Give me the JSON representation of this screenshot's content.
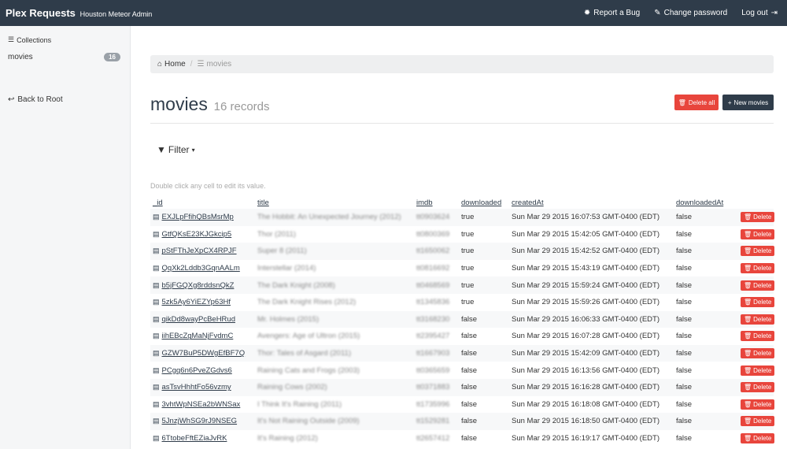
{
  "topbar": {
    "brand": "Plex Requests",
    "subtitle": "Houston Meteor Admin",
    "links": [
      {
        "icon": "bug-icon",
        "label": "Report a Bug"
      },
      {
        "icon": "pencil-icon",
        "label": "Change password"
      },
      {
        "icon": "logout-icon",
        "label": "Log out"
      }
    ]
  },
  "sidebar": {
    "header": "Collections",
    "items": [
      {
        "label": "movies",
        "count": "16"
      }
    ],
    "back": "Back to Root"
  },
  "breadcrumb": {
    "home": "Home",
    "current": "movies"
  },
  "page": {
    "title": "movies",
    "count": "16 records",
    "delete_all": "Delete all",
    "new": "New movies",
    "filter": "Filter",
    "hint": "Double click any cell to edit its value."
  },
  "table": {
    "headers": {
      "id": "_id",
      "title": "title",
      "imdb": "imdb",
      "downloaded": "downloaded",
      "createdAt": "createdAt",
      "downloadedAt": "downloadedAt"
    },
    "delete_label": "Delete",
    "rows": [
      {
        "id": "EXJLpFfihQBsMsrMp",
        "title": "The Hobbit: An Unexpected Journey (2012)",
        "imdb": "tt0903624",
        "downloaded": "true",
        "createdAt": "Sun Mar 29 2015 16:07:53 GMT-0400 (EDT)",
        "downloadedAt": "false"
      },
      {
        "id": "GtfQKsE23KJGkcip5",
        "title": "Thor (2011)",
        "imdb": "tt0800369",
        "downloaded": "true",
        "createdAt": "Sun Mar 29 2015 15:42:05 GMT-0400 (EDT)",
        "downloadedAt": "false"
      },
      {
        "id": "pStFThJeXpCX4RPJF",
        "title": "Super 8 (2011)",
        "imdb": "tt1650062",
        "downloaded": "true",
        "createdAt": "Sun Mar 29 2015 15:42:52 GMT-0400 (EDT)",
        "downloadedAt": "false"
      },
      {
        "id": "QqXk2Lddb3GqnAALm",
        "title": "Interstellar (2014)",
        "imdb": "tt0816692",
        "downloaded": "true",
        "createdAt": "Sun Mar 29 2015 15:43:19 GMT-0400 (EDT)",
        "downloadedAt": "false"
      },
      {
        "id": "b5jFGQXg8rddsnQkZ",
        "title": "The Dark Knight (2008)",
        "imdb": "tt0468569",
        "downloaded": "true",
        "createdAt": "Sun Mar 29 2015 15:59:24 GMT-0400 (EDT)",
        "downloadedAt": "false"
      },
      {
        "id": "5zk5Ay6YiEZYp63Hf",
        "title": "The Dark Knight Rises (2012)",
        "imdb": "tt1345836",
        "downloaded": "true",
        "createdAt": "Sun Mar 29 2015 15:59:26 GMT-0400 (EDT)",
        "downloadedAt": "false"
      },
      {
        "id": "qikDd8wayPcBeHRud",
        "title": "Mr. Holmes (2015)",
        "imdb": "tt3168230",
        "downloaded": "false",
        "createdAt": "Sun Mar 29 2015 16:06:33 GMT-0400 (EDT)",
        "downloadedAt": "false"
      },
      {
        "id": "iihEBcZgMaNjFvdmC",
        "title": "Avengers: Age of Ultron (2015)",
        "imdb": "tt2395427",
        "downloaded": "false",
        "createdAt": "Sun Mar 29 2015 16:07:28 GMT-0400 (EDT)",
        "downloadedAt": "false"
      },
      {
        "id": "GZW7BuP5DWgEfBF7Q",
        "title": "Thor: Tales of Asgard (2011)",
        "imdb": "tt1667903",
        "downloaded": "false",
        "createdAt": "Sun Mar 29 2015 15:42:09 GMT-0400 (EDT)",
        "downloadedAt": "false"
      },
      {
        "id": "PCgq6n6PveZGdvs6",
        "title": "Raining Cats and Frogs (2003)",
        "imdb": "tt0365659",
        "downloaded": "false",
        "createdAt": "Sun Mar 29 2015 16:13:56 GMT-0400 (EDT)",
        "downloadedAt": "false"
      },
      {
        "id": "asTsvHhhtFo56vzmy",
        "title": "Raining Cows (2002)",
        "imdb": "tt0371883",
        "downloaded": "false",
        "createdAt": "Sun Mar 29 2015 16:16:28 GMT-0400 (EDT)",
        "downloadedAt": "false"
      },
      {
        "id": "3vhtWpNSEa2bWNSax",
        "title": "I Think It's Raining (2011)",
        "imdb": "tt1735996",
        "downloaded": "false",
        "createdAt": "Sun Mar 29 2015 16:18:08 GMT-0400 (EDT)",
        "downloadedAt": "false"
      },
      {
        "id": "5JnzjWhSG9rJ9NSEG",
        "title": "It's Not Raining Outside (2009)",
        "imdb": "tt1529281",
        "downloaded": "false",
        "createdAt": "Sun Mar 29 2015 16:18:50 GMT-0400 (EDT)",
        "downloadedAt": "false"
      },
      {
        "id": "6TtobeFftEZiaJvRK",
        "title": "It's Raining (2012)",
        "imdb": "tt2657412",
        "downloaded": "false",
        "createdAt": "Sun Mar 29 2015 16:19:17 GMT-0400 (EDT)",
        "downloadedAt": "false"
      }
    ]
  }
}
